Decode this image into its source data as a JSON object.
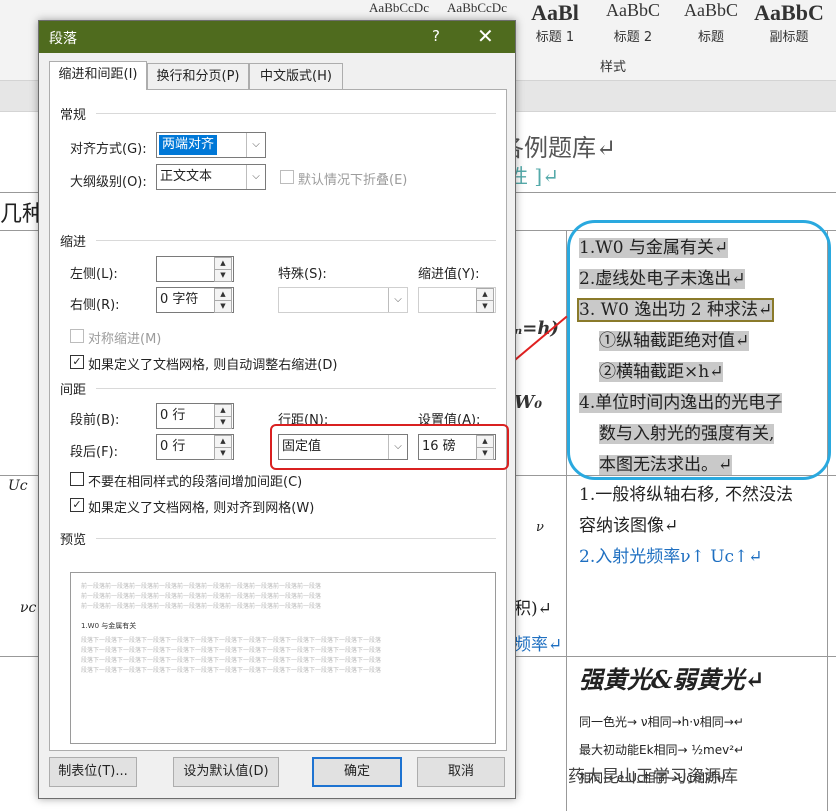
{
  "ribbon": {
    "style_samples": [
      "AaBbCcDc",
      "AaBbCcDc",
      "AaBl",
      "AaBbC",
      "AaBbC",
      "AaBbC"
    ],
    "style_names": [
      "标题 1",
      "标题 2",
      "标题",
      "副标题"
    ],
    "styles_group_label": "样式"
  },
  "document": {
    "title_fragment": "各例题库↵",
    "subtitle_fragment": "性 ]↵",
    "left_heading": "几种",
    "callout_lines": [
      "1.W0 与金属有关↵",
      "2.虚线处电子未逸出↵",
      "3. W0 逸出功 2 种求法↵",
      "①纵轴截距绝对值↵",
      "②横轴截距×h↵",
      "4.单位时间内逸出的光电子",
      "数与入射光的强度有关,",
      "本图无法求出。↵"
    ],
    "cell2_lines": [
      "1.一般将纵轴右移, 不然没法",
      "容纳该图像↵",
      "2.入射光频率ν↑ Uc↑↵"
    ],
    "cell3_title": "强黄光&弱黄光↵",
    "cell3_lines": [
      "同一色光→ ν相同→h·ν相同→↵",
      "最大初动能Ek相同→ ½mev²↵",
      "相同→ e·Uc相同→Uc相同↵"
    ],
    "side_fragments": [
      "ₙ=h)",
      "W₀",
      "Uc",
      "νc",
      "积)↵",
      "频率↵",
      "ν"
    ],
    "watermark": "药大昆山王学习资源库"
  },
  "dialog": {
    "title": "段落",
    "help": "?",
    "close": "✕",
    "tabs": [
      "缩进和间距(I)",
      "换行和分页(P)",
      "中文版式(H)"
    ],
    "general": {
      "section": "常规",
      "alignment_label": "对齐方式(G):",
      "alignment_value": "两端对齐",
      "outline_label": "大纲级别(O):",
      "outline_value": "正文文本",
      "collapse_label": "默认情况下折叠(E)"
    },
    "indent": {
      "section": "缩进",
      "left_label": "左侧(L):",
      "left_value": "",
      "right_label": "右侧(R):",
      "right_value": "0 字符",
      "special_label": "特殊(S):",
      "special_value": "",
      "indent_value_label": "缩进值(Y):",
      "indent_value": "",
      "mirror_label": "对称缩进(M)",
      "auto_adjust_label": "如果定义了文档网格, 则自动调整右缩进(D)"
    },
    "spacing": {
      "section": "间距",
      "before_label": "段前(B):",
      "before_value": "0 行",
      "after_label": "段后(F):",
      "after_value": "0 行",
      "line_spacing_label": "行距(N):",
      "line_spacing_value": "固定值",
      "at_label": "设置值(A):",
      "at_value": "16 磅",
      "no_space_label": "不要在相同样式的段落间增加间距(C)",
      "snap_grid_label": "如果定义了文档网格, 则对齐到网格(W)"
    },
    "preview": {
      "section": "预览",
      "before_text": "前一段落前一段落前一段落前一段落前一段落前一段落前一段落前一段落前一段落前一段落",
      "main_text": "1.W0 与金属有关",
      "after_text": "段落下一段落下一段落下一段落下一段落下一段落下一段落下一段落下一段落下一段落下一段落下一段落下一段落"
    },
    "buttons": {
      "tabs": "制表位(T)...",
      "default": "设为默认值(D)",
      "ok": "确定",
      "cancel": "取消"
    }
  }
}
